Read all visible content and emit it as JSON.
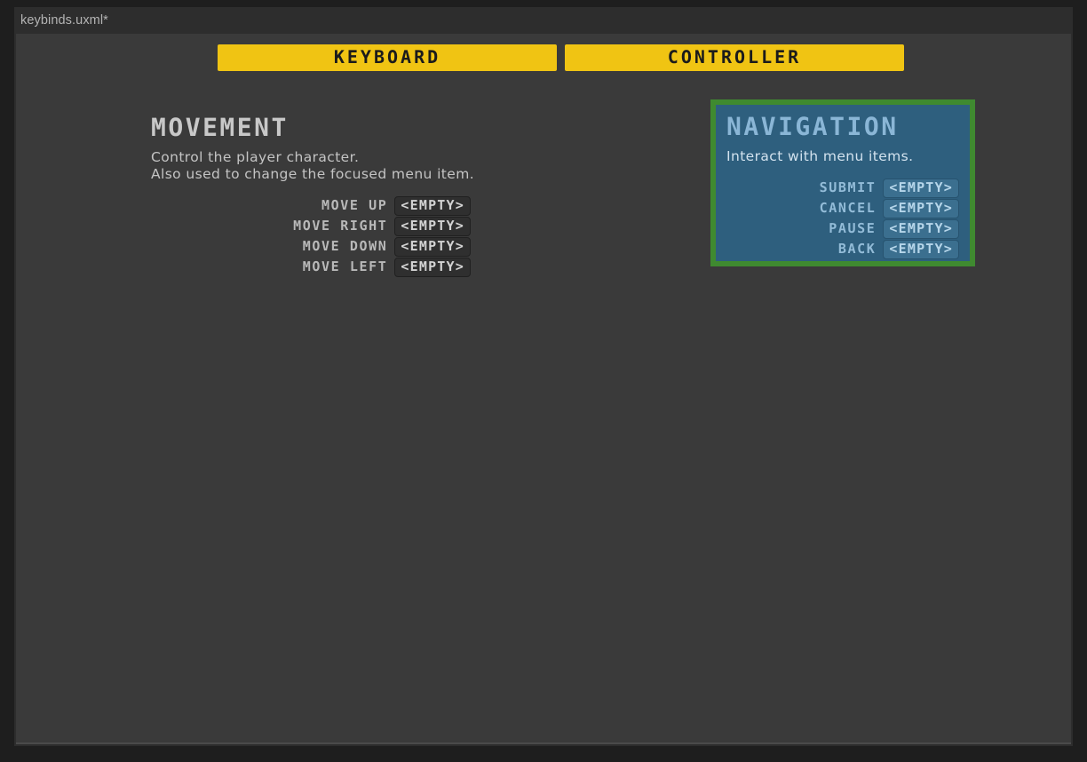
{
  "window": {
    "title": "keybinds.uxml*"
  },
  "tabs": [
    {
      "label": "KEYBOARD",
      "name": "tab-keyboard"
    },
    {
      "label": "CONTROLLER",
      "name": "tab-controller"
    }
  ],
  "sections": {
    "movement": {
      "heading": "MOVEMENT",
      "description_line1": "Control the player character.",
      "description_line2": "Also used to change the focused menu item.",
      "bindings": [
        {
          "label": "MOVE UP",
          "value": "<EMPTY>"
        },
        {
          "label": "MOVE RIGHT",
          "value": "<EMPTY>"
        },
        {
          "label": "MOVE DOWN",
          "value": "<EMPTY>"
        },
        {
          "label": "MOVE LEFT",
          "value": "<EMPTY>"
        }
      ]
    },
    "navigation": {
      "heading": "NAVIGATION",
      "description_line1": "Interact with menu items.",
      "bindings": [
        {
          "label": "SUBMIT",
          "value": "<EMPTY>"
        },
        {
          "label": "CANCEL",
          "value": "<EMPTY>"
        },
        {
          "label": "PAUSE",
          "value": "<EMPTY>"
        },
        {
          "label": "BACK",
          "value": "<EMPTY>"
        }
      ]
    }
  },
  "colors": {
    "tab_accent": "#f0c413",
    "selection_border": "#3f8a30",
    "panel_background": "#2e5f7e",
    "canvas_background": "#3a3a3a",
    "window_chrome": "#2d2d2d"
  }
}
